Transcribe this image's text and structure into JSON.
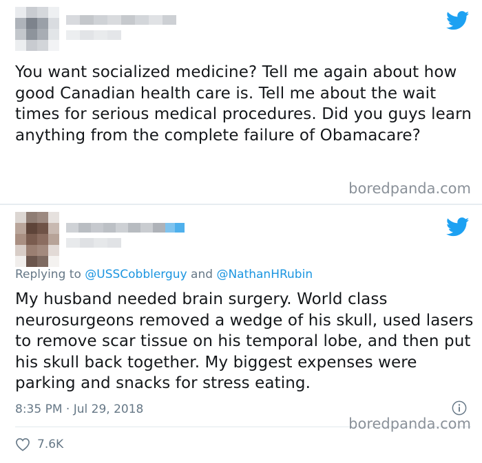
{
  "tweet1": {
    "text": "You want socialized medicine? Tell me again about how good Canadian health care is. Tell me about the wait times for serious medical procedures. Did you guys learn anything from the complete failure of Obamacare?",
    "watermark": "boredpanda.com"
  },
  "tweet2": {
    "reply_prefix": "Replying to ",
    "mention1": "@USSCobblerguy",
    "reply_and": " and ",
    "mention2": "@NathanHRubin",
    "text": "My husband needed brain surgery. World class neurosurgeons removed a wedge of his skull, used lasers to remove scar tissue on his temporal lobe, and then put his skull back together. My biggest expenses were parking and snacks for stress eating.",
    "timestamp": "8:35 PM · Jul 29, 2018",
    "likes": "7.6K",
    "watermark": "boredpanda.com"
  },
  "colors": {
    "twitter_blue": "#1da1f2",
    "mention_blue": "#1b95e0",
    "muted_text": "#657786"
  },
  "icons": [
    "twitter-bird-icon",
    "info-icon",
    "heart-icon"
  ]
}
